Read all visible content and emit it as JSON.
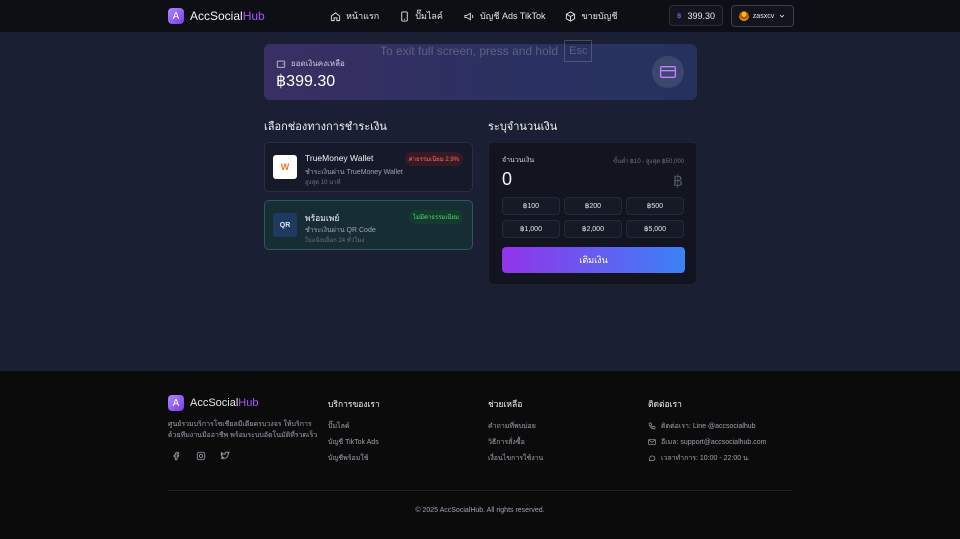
{
  "header": {
    "logo_letter": "A",
    "brand_main": "AccSocial",
    "brand_accent": "Hub",
    "nav": [
      {
        "label": "หน้าแรก",
        "icon": "home-icon"
      },
      {
        "label": "ปั๊มไลค์",
        "icon": "phone-icon"
      },
      {
        "label": "บัญชี Ads TikTok",
        "icon": "megaphone-icon"
      },
      {
        "label": "ขายบัญชี",
        "icon": "box-icon"
      }
    ],
    "balance_symbol": "฿",
    "balance": "399.30",
    "username": "zasxcv"
  },
  "overlay": {
    "text": "To exit full screen, press and hold",
    "key": "Esc"
  },
  "balance_card": {
    "label": "ยอดเงินคงเหลือ",
    "amount": "฿399.30"
  },
  "payment": {
    "title": "เลือกช่องทางการชำระเงิน",
    "methods": [
      {
        "name": "TrueMoney Wallet",
        "desc": "ชำระเงินผ่าน TrueMoney Wallet",
        "sub": "สูงสุด 10 นาที",
        "badge": "ค่าธรรมเนียม 2.9%",
        "logo_text": "W"
      },
      {
        "name": "พร้อมเพย์",
        "desc": "ชำระเงินผ่าน QR Code",
        "sub": "ใบแจ้งบล็อก 24 ชั่วโมง",
        "badge": "ไม่มีค่าธรรมเนียม",
        "logo_text": "QR"
      }
    ]
  },
  "amount": {
    "title": "ระบุจำนวนเงิน",
    "label": "จำนวนเงิน",
    "range": "ขั้นต่ำ ฿10 - สูงสุด ฿50,000",
    "value": "0",
    "currency": "฿",
    "quick": [
      "฿100",
      "฿200",
      "฿500",
      "฿1,000",
      "฿2,000",
      "฿5,000"
    ],
    "submit": "เติมเงิน"
  },
  "footer": {
    "logo_letter": "A",
    "brand_main": "AccSocial",
    "brand_accent": "Hub",
    "desc": "ศูนย์รวมบริการโซเชียลมีเดียครบวงจร ให้บริการด้วยทีมงานมืออาชีพ พร้อมระบบอัตโนมัติที่รวดเร็ว",
    "services": {
      "title": "บริการของเรา",
      "links": [
        "ปั๊มไลค์",
        "บัญชี TikTok Ads",
        "บัญชีพร้อมใช้"
      ]
    },
    "help": {
      "title": "ช่วยเหลือ",
      "links": [
        "คำถามที่พบบ่อย",
        "วิธีการสั่งซื้อ",
        "เงื่อนไขการใช้งาน"
      ]
    },
    "contact": {
      "title": "ติดต่อเรา",
      "items": [
        {
          "text": "ติดต่อเรา: Line @accsocialhub",
          "icon": "phone-icon"
        },
        {
          "text": "อีเมล: support@accsocialhub.com",
          "icon": "mail-icon"
        },
        {
          "text": "เวลาทำการ: 10:00 - 22:00 น.",
          "icon": "chat-icon"
        }
      ]
    },
    "copyright": "© 2025 AccSocialHub. All rights reserved."
  }
}
